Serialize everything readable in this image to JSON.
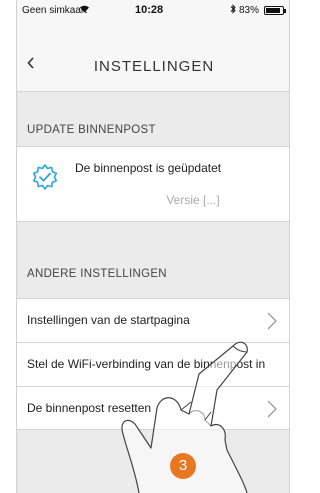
{
  "status_bar": {
    "carrier": "Geen simkaart",
    "time": "10:28",
    "battery": "83%"
  },
  "header": {
    "title": "INSTELLINGEN",
    "back_icon": "chevron-left-icon"
  },
  "update_section": {
    "label": "UPDATE BINNENPOST",
    "message": "De binnenpost is geüpdatet",
    "version": "Versie [...]",
    "icon": "gear-check-icon",
    "accent_color": "#2aa7e0"
  },
  "other_section": {
    "label": "ANDERE INSTELLINGEN",
    "items": [
      {
        "label": "Instellingen van de startpagina"
      },
      {
        "label": "Stel de WiFi-verbinding van de binnenpost in"
      },
      {
        "label": "De binnenpost resetten"
      }
    ]
  },
  "step_badge": "3",
  "colors": {
    "badge": "#e87722",
    "background": "#ebebeb"
  }
}
